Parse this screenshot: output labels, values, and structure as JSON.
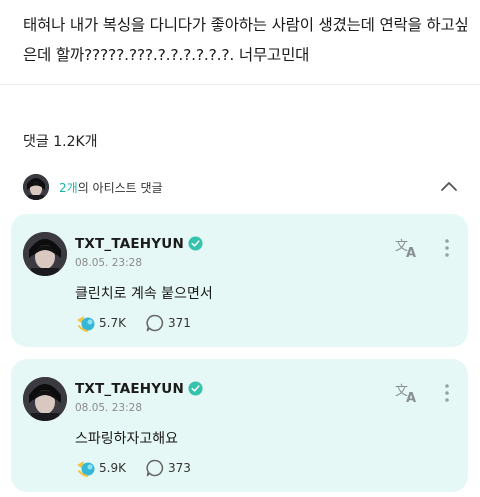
{
  "post": {
    "text": "태혀나 내가 복싱을 다니다가 좋아하는 사람이 생겼는데 연락을 하고싶은데 할까?????.???.?.?.?.?.?.?. 너무고민대"
  },
  "comments_header": {
    "label": "댓글 1.2K개"
  },
  "artist_comments": {
    "count": "2개",
    "label": "의 아티스트 댓글"
  },
  "comments": [
    {
      "author": "TXT_TAEHYUN",
      "time": "08.05. 23:28",
      "text": "클린치로 계속 붙으면서",
      "likes": "5.7K",
      "replies": "371"
    },
    {
      "author": "TXT_TAEHYUN",
      "time": "08.05. 23:28",
      "text": "스파링하자고해요",
      "likes": "5.9K",
      "replies": "373"
    }
  ],
  "colors": {
    "card_bg": "#e6f8f5",
    "accent": "#14b8a6",
    "verified": "#35c3ad"
  },
  "icons": [
    "verified-badge-icon",
    "translate-icon",
    "more-options-icon",
    "like-reaction-icon",
    "reply-bubble-icon",
    "chevron-up-icon"
  ]
}
